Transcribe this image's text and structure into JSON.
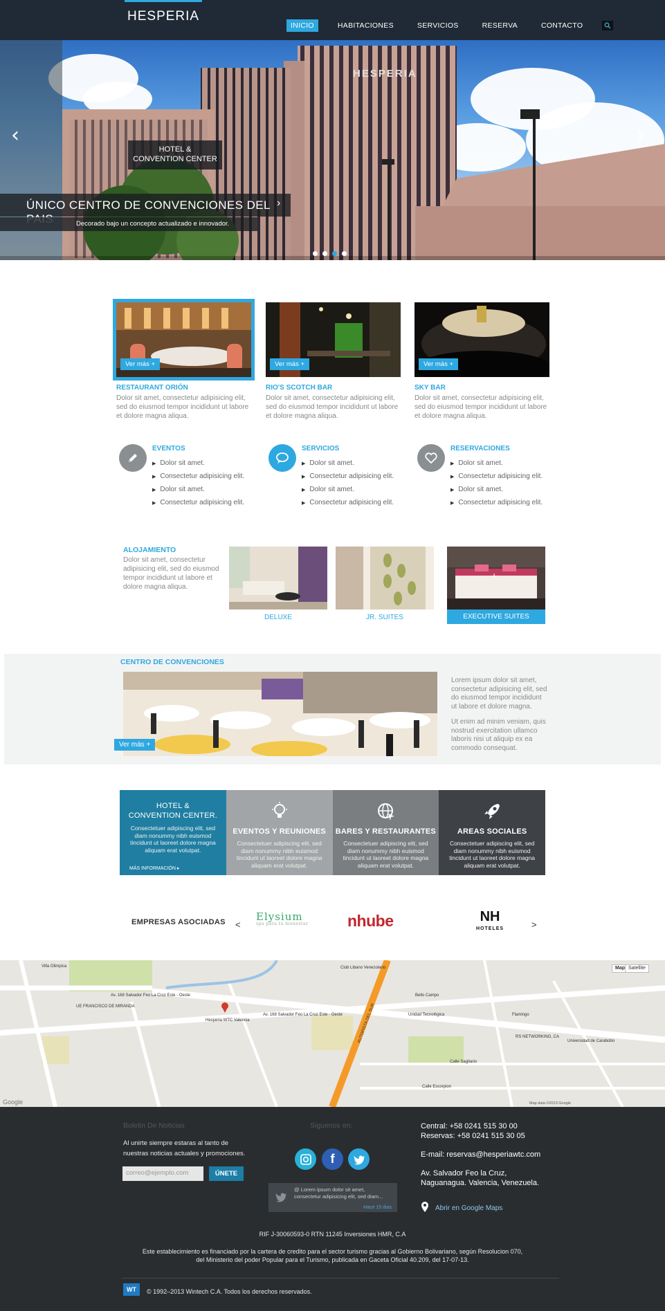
{
  "header": {
    "logo": "HESPERIA",
    "nav": [
      "INICIO",
      "HABITACIONES",
      "SERVICIOS",
      "RESERVA",
      "CONTACTO"
    ]
  },
  "hero": {
    "building_sign": "HESPERIA",
    "badge_line1": "HOTEL &",
    "badge_line2": "CONVENTION CENTER",
    "title": "ÚNICO CENTRO DE CONVENCIONES DEL PAIS",
    "subtitle": "Decorado bajo un concepto actualizado e innovador.",
    "slides": 4,
    "active_slide": 3
  },
  "features": [
    {
      "button": "Ver más +",
      "title": "RESTAURANT ORIÓN",
      "text": "Dolor sit amet, consectetur adipisicing elit, sed do eiusmod tempor incididunt ut labore et dolore magna aliqua."
    },
    {
      "button": "Ver más +",
      "title": "RIO'S SCOTCH BAR",
      "text": "Dolor sit amet, consectetur adipisicing elit, sed do eiusmod tempor incididunt ut labore et dolore magna aliqua."
    },
    {
      "button": "Ver más +",
      "title": "SKY BAR",
      "text": "Dolor sit amet, consectetur adipisicing elit, sed do eiusmod tempor incididunt ut labore et dolore magna aliqua."
    }
  ],
  "services": [
    {
      "title": "EVENTOS",
      "icon": "pencil-icon",
      "items": [
        "Dolor sit amet.",
        "Consectetur adipisicing elit.",
        "Dolor sit amet.",
        "Consectetur adipisicing elit."
      ]
    },
    {
      "title": "SERVICIOS",
      "icon": "chat-bubble-icon",
      "items": [
        "Dolor sit amet.",
        "Consectetur adipisicing elit.",
        "Dolor sit amet.",
        "Consectetur adipisicing elit."
      ]
    },
    {
      "title": "RESERVACIONES",
      "icon": "heart-icon",
      "items": [
        "Dolor sit amet.",
        "Consectetur adipisicing elit.",
        "Dolor sit amet.",
        "Consectetur adipisicing elit."
      ]
    }
  ],
  "alojamiento": {
    "title": "ALOJAMIENTO",
    "text": "Dolor sit amet, consectetur adipisicing elit, sed do eiusmod tempor incididunt ut labore et dolore magna aliqua.",
    "rooms": [
      "DELUXE",
      "JR. SUITES",
      "EXECUTIVE SUITES"
    ]
  },
  "convenciones": {
    "title": "CENTRO DE CONVENCIONES",
    "button": "Ver más +",
    "text1": "Lorem ipsum dolor sit amet, consectetur adipisicing elit, sed do eiusmod tempor incididunt ut labore et dolore magna.",
    "text2": "Ut enim ad minim veniam, quis nostrud exercitation ullamco laboris nisi ut aliquip ex ea commodo consequat."
  },
  "panels": [
    {
      "title_line1": "HOTEL &",
      "title_line2": "CONVENTION CENTER.",
      "text": "Consectetuer adipiscing elit, sed diam nonummy nibh euismod tincidunt ut laoreet dolore magna aliquam erat volutpat.",
      "more": "MÁS INFORMACIÓN ▸",
      "color": "#1f7ea2"
    },
    {
      "title": "EVENTOS Y REUNIONES",
      "icon": "lightbulb-icon",
      "text": "Consectetuer adipiscing elit, sed diam nonummy nibh euismod tincidunt ut laoreet dolore magna aliquam erat volutpat.",
      "color": "#a1a5a7"
    },
    {
      "title": "BARES Y RESTAURANTES",
      "icon": "globe-icon",
      "text": "Consectetuer adipiscing elit, sed diam nonummy nibh euismod tincidunt ut laoreet dolore magna aliquam erat volutpat.",
      "color": "#7a7e81"
    },
    {
      "title": "AREAS SOCIALES",
      "icon": "rocket-icon",
      "text": "Consectetuer adipiscing elit, sed diam nonummy nibh euismod tincidunt ut laoreet dolore magna aliquam erat volutpat.",
      "color": "#3e4247"
    }
  ],
  "partners": {
    "title": "EMPRESAS ASOCIADAS",
    "prev": "<",
    "next": ">",
    "logos": {
      "elysium": "Elysium",
      "elysium_tag": "spa para tu bienestar",
      "nhube": "nhube",
      "nh": "NH",
      "nh_sub": "HOTELES"
    }
  },
  "map": {
    "labels": {
      "club": "Club Libano Venezolano",
      "hesperia": "Hesperia WTC Valencia",
      "avenue1": "Av. 168 Salvador Feo La Cruz Este - Oeste",
      "avenue2": "Av. 168 Salvador Feo La Cruz Este - Oeste",
      "colegio": "UE FRANCISCO DE MIRANDA",
      "bello": "Bello Campo",
      "unidad": "Unidad Tecnológica",
      "flamingo": "Flamingo",
      "rs": "RS NETWORKING, CA",
      "upt": "Universidad de Carabobo",
      "sagitario": "Calle Sagitario",
      "escorpion": "Calle Escorpion",
      "autopista": "AUTOPISTA DEL SUR",
      "villa": "Villa Olimpica",
      "google": "Google",
      "mapdata": "Map data ©2013 Google"
    },
    "buttons": [
      "Map",
      "Satellite"
    ]
  },
  "footer": {
    "newsletter_title": "Boletin De Noticias",
    "newsletter_text": "Al unirte siempre estaras al tanto de nuestras noticias actuales y promociones.",
    "email_placeholder": "correo@ejemplo.com",
    "join": "ÚNETE",
    "follow": "Siguenos en:",
    "tweet_text": "@ Lorem ipsum dolor sit amet, consectetur adipisicing elit, sed diam...",
    "tweet_time": "Hace 15 dias",
    "phone1": "Central: +58 0241 515 30 00",
    "phone2": "Reservas: +58 0241 515 30 05",
    "email": "E-mail: reservas@hesperiawtc.com",
    "address1": "Av. Salvador Feo la Cruz,",
    "address2": "Naguanagua. Valencia, Venezuela.",
    "maps_link": "Abrir en Google Maps",
    "rif": "RIF J-30060593-0 RTN 11245 Inversiones HMR, C.A",
    "legal1": "Este establecimiento es financiado por la cartera de credito para el sector turismo gracias al Gobierno Bolivariano, según Resolucion 070,",
    "legal2": "del Ministerio del poder Popular para el Turismo, publicada en Gaceta Oficial 40.209, del 17-07-13.",
    "copyright": "© 1992–2013 Wintech C.A. Todos los derechos reservados.",
    "wintech_logo": "WT"
  },
  "colors": {
    "accent": "#2ea8e0",
    "header": "#1f2a36",
    "footer": "#2a2d30"
  }
}
